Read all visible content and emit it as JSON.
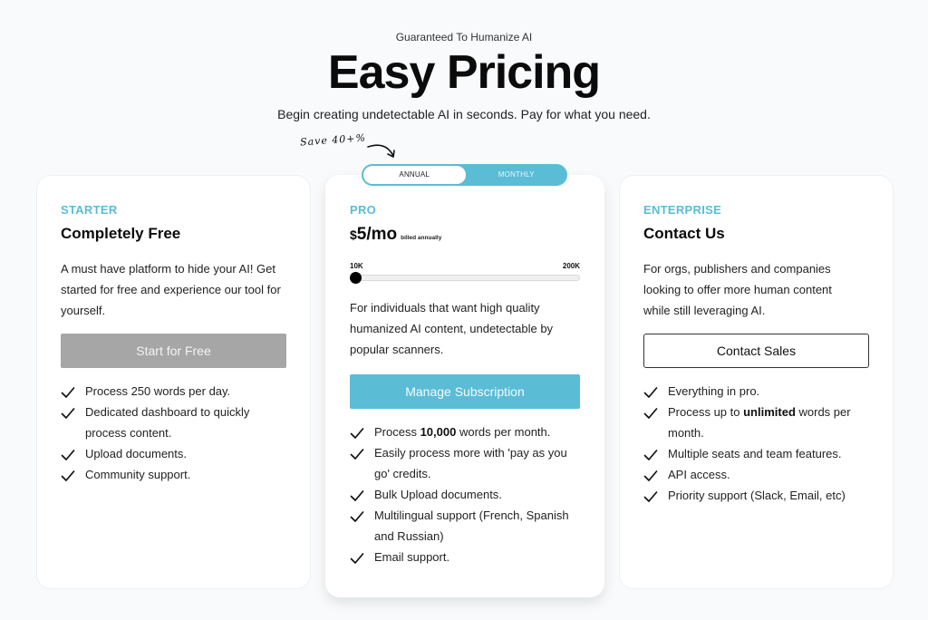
{
  "header": {
    "eyebrow": "Guaranteed To Humanize AI",
    "title": "Easy Pricing",
    "subtitle": "Begin creating undetectable AI in seconds. Pay for what you need."
  },
  "billing_toggle": {
    "save_note": "Save 40+%",
    "options": [
      "ANNUAL",
      "MONTHLY"
    ],
    "selected": "ANNUAL"
  },
  "colors": {
    "accent": "#5bbcd6",
    "background": "#f8fafc",
    "disabled_button": "#a6a6a6"
  },
  "plans": [
    {
      "tier": "STARTER",
      "name": "Completely Free",
      "description": "A must have platform to hide your AI! Get started for free and experience our tool for yourself.",
      "button": "Start for Free",
      "features": [
        {
          "text": "Process 250 words per day."
        },
        {
          "text": "Dedicated dashboard to quickly process content."
        },
        {
          "text": "Upload documents."
        },
        {
          "text": "Community support."
        }
      ]
    },
    {
      "tier": "PRO",
      "price": {
        "currency": "$",
        "amount": "5/mo",
        "billing": "billed annually"
      },
      "slider": {
        "min_label": "10K",
        "max_label": "200K",
        "value_fraction": 0.0
      },
      "description": "For individuals that want high quality humanized AI content, undetectable by popular scanners.",
      "button": "Manage Subscription",
      "features": [
        {
          "pre": "Process ",
          "bold": "10,000",
          "post": " words per month."
        },
        {
          "text": "Easily process more with 'pay as you go' credits."
        },
        {
          "text": "Bulk Upload documents."
        },
        {
          "text": "Multilingual support (French, Spanish and Russian)"
        },
        {
          "text": "Email support."
        }
      ]
    },
    {
      "tier": "ENTERPRISE",
      "name": "Contact Us",
      "description": "For orgs, publishers and companies looking to offer more human content while still leveraging AI.",
      "button": "Contact Sales",
      "features": [
        {
          "text": "Everything in pro."
        },
        {
          "pre": "Process up to ",
          "bold": "unlimited",
          "post": " words per month."
        },
        {
          "text": "Multiple seats and team features."
        },
        {
          "text": "API access."
        },
        {
          "text": "Priority support (Slack, Email, etc)"
        }
      ]
    }
  ]
}
